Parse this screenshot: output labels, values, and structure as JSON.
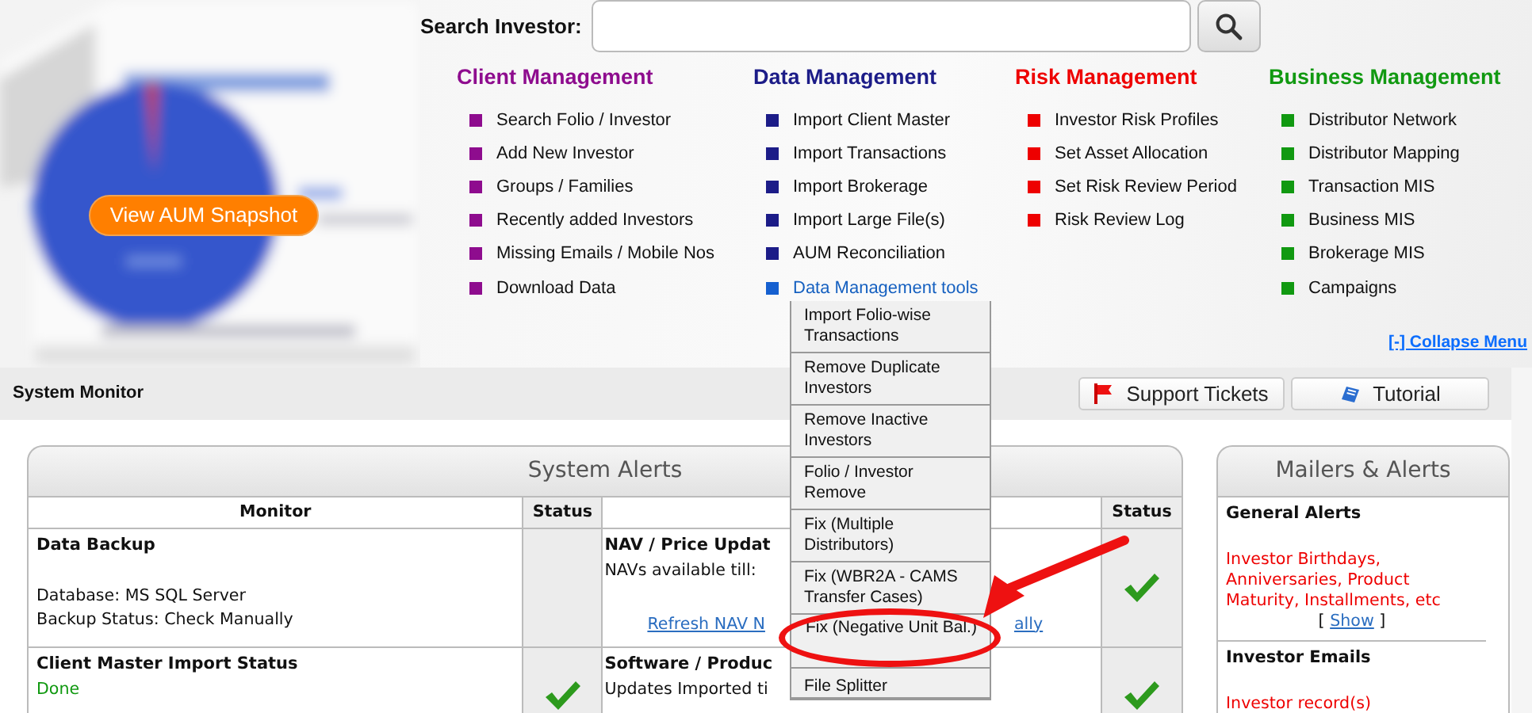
{
  "search": {
    "label": "Search Investor:"
  },
  "aum_button": "View AUM Snapshot",
  "menus": [
    {
      "title": "Client Management",
      "color": "#8e0c8e",
      "items": [
        "Search Folio / Investor",
        "Add New Investor",
        "Groups / Families",
        "Recently added Investors",
        "Missing Emails / Mobile Nos",
        "Download Data"
      ]
    },
    {
      "title": "Data Management",
      "color": "#1c1c88",
      "items": [
        "Import Client Master",
        "Import Transactions",
        "Import Brokerage",
        "Import Large File(s)",
        "AUM Reconciliation"
      ],
      "tools": {
        "label": "Data Management tools",
        "expanded": true,
        "items": [
          {
            "label": "Import Folio-wise Transactions",
            "circled": false
          },
          {
            "label": "Remove Duplicate Investors",
            "circled": false
          },
          {
            "label": "Remove Inactive Investors",
            "circled": false
          },
          {
            "label": "Folio / Investor Remove",
            "circled": false
          },
          {
            "label": "Fix (Multiple Distributors)",
            "circled": false
          },
          {
            "label": "Fix (WBR2A - CAMS Transfer Cases)",
            "circled": false
          },
          {
            "label": "Fix (Negative Unit Bal.)",
            "circled": true
          },
          {
            "label": "File Splitter",
            "circled": false
          }
        ]
      }
    },
    {
      "title": "Risk Management",
      "color": "#ee0000",
      "items": [
        "Investor Risk Profiles",
        "Set Asset Allocation",
        "Set Risk Review Period",
        "Risk Review Log"
      ]
    },
    {
      "title": "Business Management",
      "color": "#119911",
      "items": [
        "Distributor Network",
        "Distributor Mapping",
        "Transaction MIS",
        "Business MIS",
        "Brokerage MIS",
        "Campaigns"
      ]
    }
  ],
  "collapse_link": "[-] Collapse Menu",
  "section_title": "System Monitor",
  "toolbar": [
    {
      "label": "Support Tickets",
      "kind": "flag"
    },
    {
      "label": "Tutorial",
      "kind": "book"
    }
  ],
  "system_alerts": {
    "title": "System Alerts",
    "columns": [
      {
        "label": "Monitor"
      },
      {
        "label": "Status"
      },
      {},
      {
        "label": "Status"
      }
    ],
    "rows": [
      {
        "left": {
          "title": "Data Backup",
          "lines": [
            "Database: MS SQL Server",
            "Backup Status: Check Manually"
          ],
          "checked": false
        },
        "right": {
          "title": "NAV / Price Updat",
          "lines": [
            "NAVs available till:"
          ],
          "link_parts": [
            "Refresh NAV N",
            "ally"
          ],
          "checked": true
        }
      },
      {
        "left": {
          "title": "Client Master Import Status",
          "value": "Done",
          "checked": true
        },
        "right": {
          "title": "Software / Produc",
          "lines": [
            "Updates Imported ti"
          ],
          "checked": true
        }
      }
    ]
  },
  "mailers": {
    "title": "Mailers & Alerts",
    "sections": [
      {
        "title": "General Alerts",
        "text": "Investor Birthdays, Anniversaries, Product Maturity, Installments, etc",
        "link_open": "[",
        "link": "Show",
        "link_close": "]"
      },
      {
        "title": "Investor Emails",
        "text": "Investor record(s)"
      }
    ]
  }
}
